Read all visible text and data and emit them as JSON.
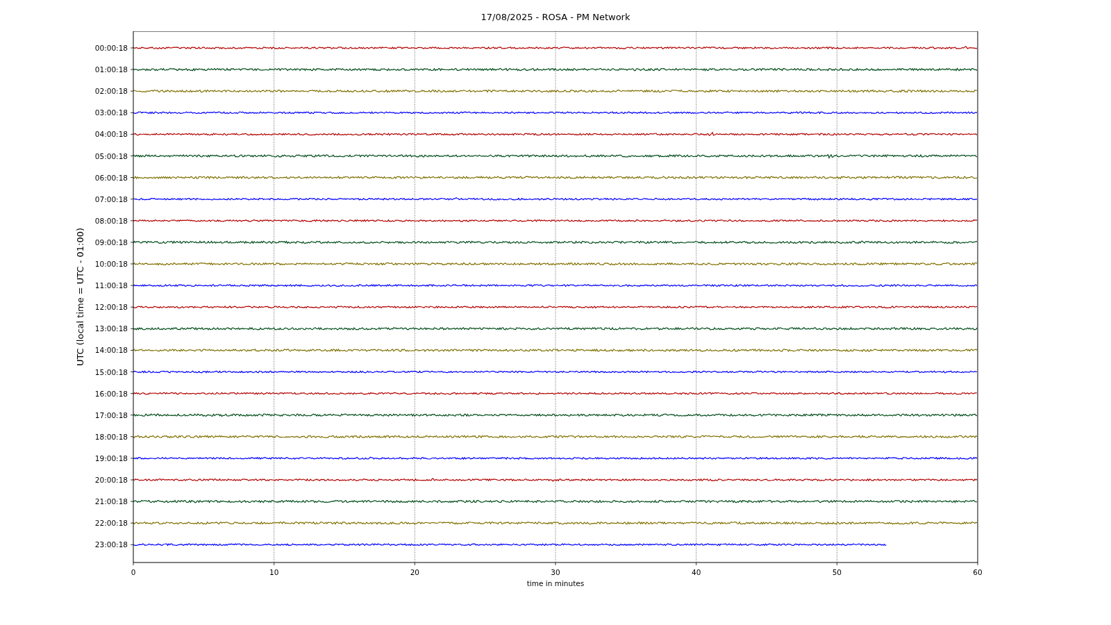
{
  "title": "17/08/2025 - ROSA - PM Network",
  "y_axis_label": "UTC (local time = UTC - 01:00)",
  "x_axis_label": "time in minutes",
  "x_ticks": [
    "0",
    "10",
    "20",
    "30",
    "40",
    "50",
    "60"
  ],
  "traces": [
    {
      "label": "00:00:18",
      "color": "#b30000"
    },
    {
      "label": "01:00:18",
      "color": "#004d1a"
    },
    {
      "label": "02:00:18",
      "color": "#807000"
    },
    {
      "label": "03:00:18",
      "color": "#0000ff"
    },
    {
      "label": "04:00:18",
      "color": "#b30000"
    },
    {
      "label": "05:00:18",
      "color": "#004d1a"
    },
    {
      "label": "06:00:18",
      "color": "#807000"
    },
    {
      "label": "07:00:18",
      "color": "#0000ff"
    },
    {
      "label": "08:00:18",
      "color": "#b30000"
    },
    {
      "label": "09:00:18",
      "color": "#004d1a"
    },
    {
      "label": "10:00:18",
      "color": "#807000"
    },
    {
      "label": "11:00:18",
      "color": "#0000ff"
    },
    {
      "label": "12:00:18",
      "color": "#b30000"
    },
    {
      "label": "13:00:18",
      "color": "#004d1a"
    },
    {
      "label": "14:00:18",
      "color": "#807000"
    },
    {
      "label": "15:00:18",
      "color": "#0000ff"
    },
    {
      "label": "16:00:18",
      "color": "#b30000"
    },
    {
      "label": "17:00:18",
      "color": "#004d1a"
    },
    {
      "label": "18:00:18",
      "color": "#807000"
    },
    {
      "label": "19:00:18",
      "color": "#0000ff"
    },
    {
      "label": "20:00:18",
      "color": "#b30000"
    },
    {
      "label": "21:00:18",
      "color": "#004d1a"
    },
    {
      "label": "22:00:18",
      "color": "#807000"
    },
    {
      "label": "23:00:18",
      "color": "#0000ff"
    }
  ]
}
